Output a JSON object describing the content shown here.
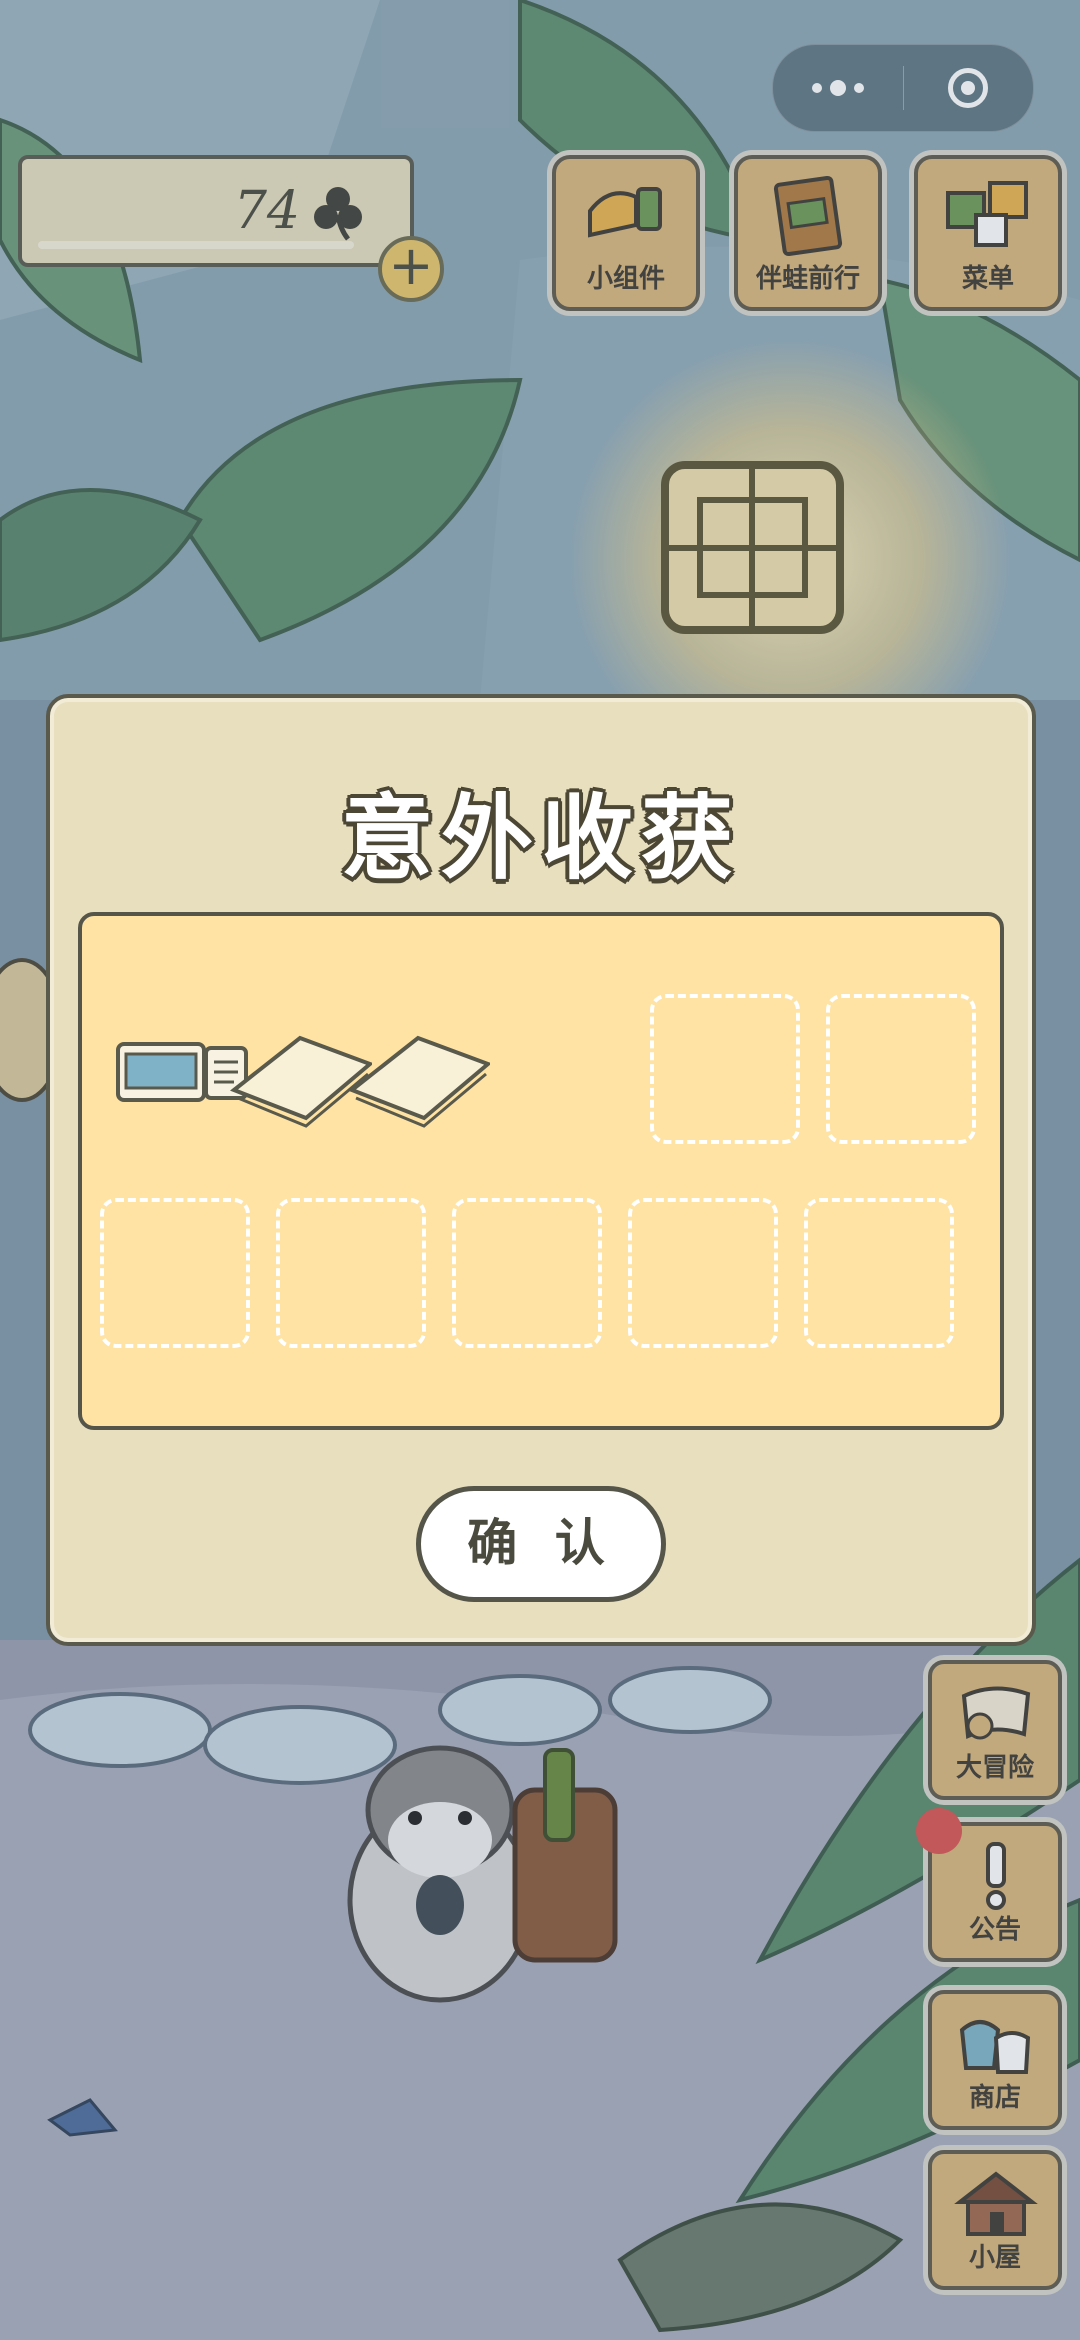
{
  "app": {
    "capsule": {
      "more_icon": "more-dots-icon",
      "close_icon": "target-close-icon"
    },
    "currency": {
      "value": "74",
      "icon": "clover-icon"
    },
    "top_menu": [
      {
        "label": "小组件",
        "icon": "widget-icon"
      },
      {
        "label": "伴蛙前行",
        "icon": "journal-icon"
      },
      {
        "label": "菜单",
        "icon": "menu-cards-icon"
      }
    ],
    "side_menu": [
      {
        "label": "大冒险",
        "icon": "adventure-map-icon"
      },
      {
        "label": "公告",
        "icon": "exclamation-icon",
        "has_badge": true
      },
      {
        "label": "商店",
        "icon": "shop-bags-icon"
      },
      {
        "label": "小屋",
        "icon": "house-icon"
      }
    ]
  },
  "dialog": {
    "title": "意外收获",
    "items": [
      {
        "name": "ticket",
        "icon": "ticket-icon"
      },
      {
        "name": "paper",
        "icon": "paper-sheet-icon"
      },
      {
        "name": "paper",
        "icon": "paper-sheet-icon"
      },
      {
        "name": "",
        "icon": ""
      },
      {
        "name": "",
        "icon": ""
      },
      {
        "name": "",
        "icon": ""
      },
      {
        "name": "",
        "icon": ""
      },
      {
        "name": "",
        "icon": ""
      },
      {
        "name": "",
        "icon": ""
      },
      {
        "name": "",
        "icon": ""
      }
    ],
    "confirm_label": "确 认"
  },
  "colors": {
    "panel": "#e8dfbf",
    "grid": "#fee3a4",
    "outline": "#55554a",
    "button_wood": "#d9b57a",
    "badge": "#d9534f"
  }
}
